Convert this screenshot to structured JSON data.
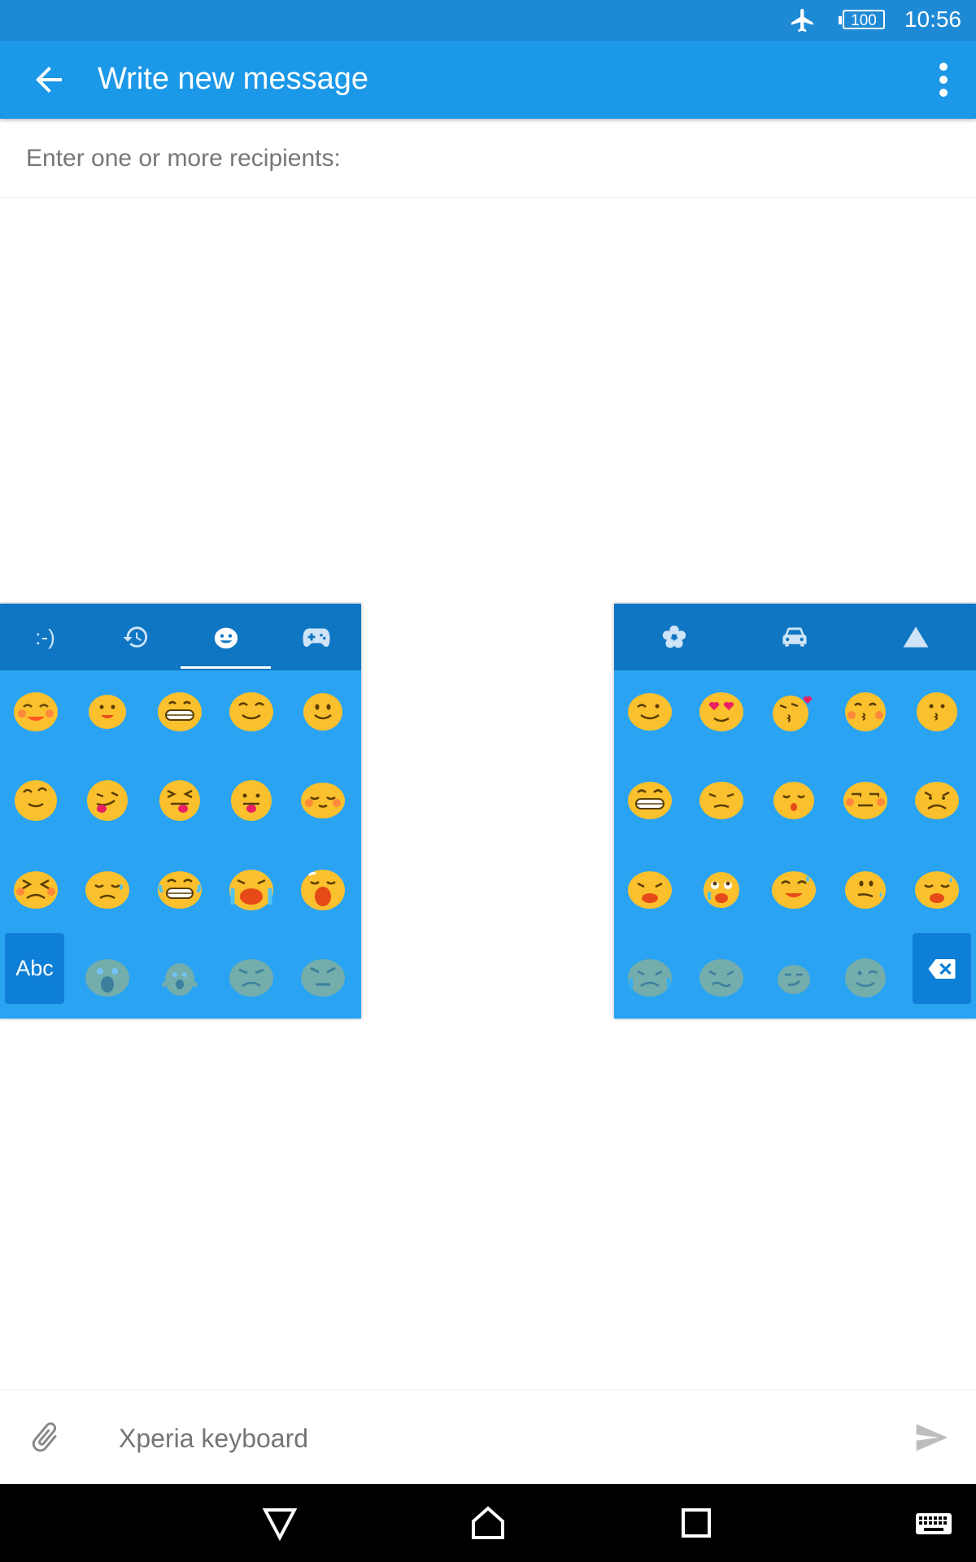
{
  "status_bar": {
    "time": "10:56",
    "battery": "100"
  },
  "app_bar": {
    "title": "Write new message"
  },
  "recipients": {
    "placeholder": "Enter one or more recipients:"
  },
  "emoji_keyboard": {
    "tabs": [
      "emoticons",
      "recent",
      "smileys",
      "games",
      "nature",
      "transport",
      "symbols"
    ],
    "emoticon_tab_label": ":-)",
    "active_tab": "smileys",
    "abc_label": "Abc"
  },
  "compose": {
    "placeholder": "Xperia keyboard"
  },
  "colors": {
    "status_bar": "#1e8ad6",
    "app_bar": "#1b98e8",
    "keyboard": "#2aa3f2",
    "keyboard_tabs": "#0f76c4",
    "emoji": "#fbc02d"
  }
}
